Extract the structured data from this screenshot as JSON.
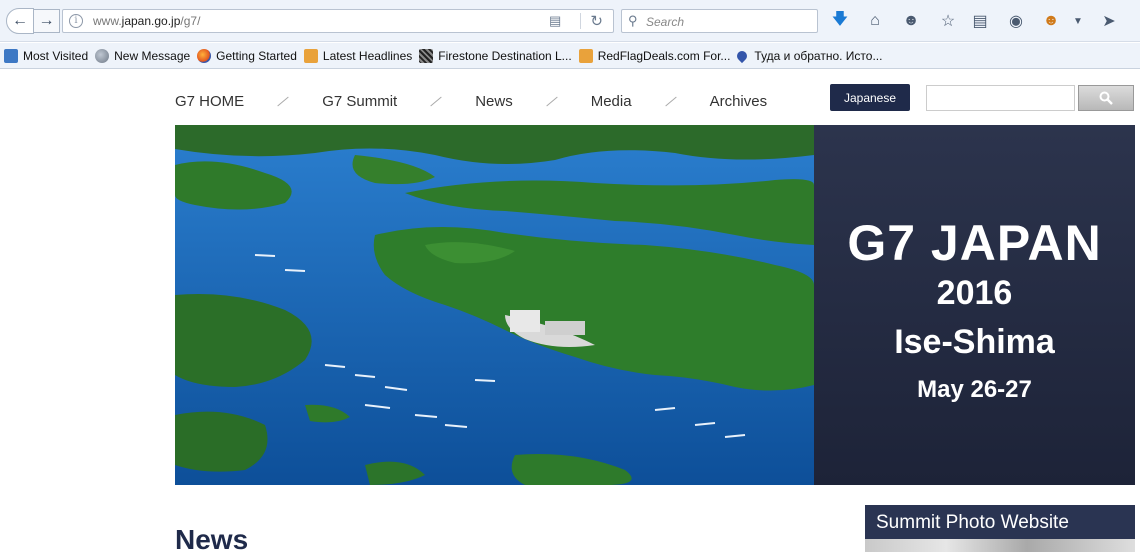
{
  "browser": {
    "url_prefix": "www.",
    "url_host": "japan.go.jp",
    "url_path": "/g7/",
    "search_placeholder": "Search"
  },
  "bookmarks": [
    {
      "label": "Most Visited",
      "icon": "bookmark-folder-icon"
    },
    {
      "label": "New Message",
      "icon": "globe-icon"
    },
    {
      "label": "Getting Started",
      "icon": "firefox-icon"
    },
    {
      "label": "Latest Headlines",
      "icon": "rss-icon"
    },
    {
      "label": "Firestone Destination L...",
      "icon": "firestone-icon"
    },
    {
      "label": "RedFlagDeals.com For...",
      "icon": "rss-icon"
    },
    {
      "label": "Туда и обратно. Исто...",
      "icon": "map-pin-icon"
    }
  ],
  "site": {
    "nav": [
      "G7 HOME",
      "G7 Summit",
      "News",
      "Media",
      "Archives"
    ],
    "japanese_label": "Japanese",
    "hero": {
      "title": "G7 JAPAN",
      "year": "2016",
      "place": "Ise-Shima",
      "date": "May 26-27"
    },
    "news_heading": "News",
    "photo_site_label": "Summit Photo Website"
  },
  "colors": {
    "navy": "#1f2a4a",
    "hero_panel": "#232a42",
    "sea": "#1a6fc0",
    "land": "#2f7a2a"
  }
}
